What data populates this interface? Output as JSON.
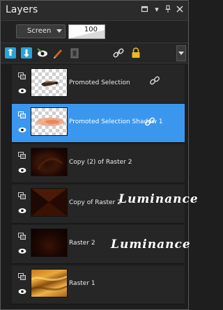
{
  "panel": {
    "title": "Layers"
  },
  "controls": {
    "blend_mode": "Screen",
    "opacity": "100"
  },
  "layers": [
    {
      "name": "Promoted Selection",
      "linked": true,
      "selected": false,
      "thumb": "check-brush"
    },
    {
      "name": "Promoted Selection Shadow 1",
      "linked": true,
      "selected": true,
      "thumb": "check-orange"
    },
    {
      "name": "Copy (2) of Raster 2",
      "linked": false,
      "selected": false,
      "thumb": "dark-brown"
    },
    {
      "name": "Copy of Raster 2",
      "linked": false,
      "selected": false,
      "thumb": "dark-rays",
      "blend_label": "Luminance"
    },
    {
      "name": "Raster 2",
      "linked": false,
      "selected": false,
      "thumb": "dark-glow",
      "blend_label": "Luminance"
    },
    {
      "name": "Raster 1",
      "linked": false,
      "selected": false,
      "thumb": "gold-waves"
    }
  ],
  "colors": {
    "selected_row": "#3b97ee",
    "panel_bg": "#1d1d1d",
    "row_bg": "#262626"
  }
}
